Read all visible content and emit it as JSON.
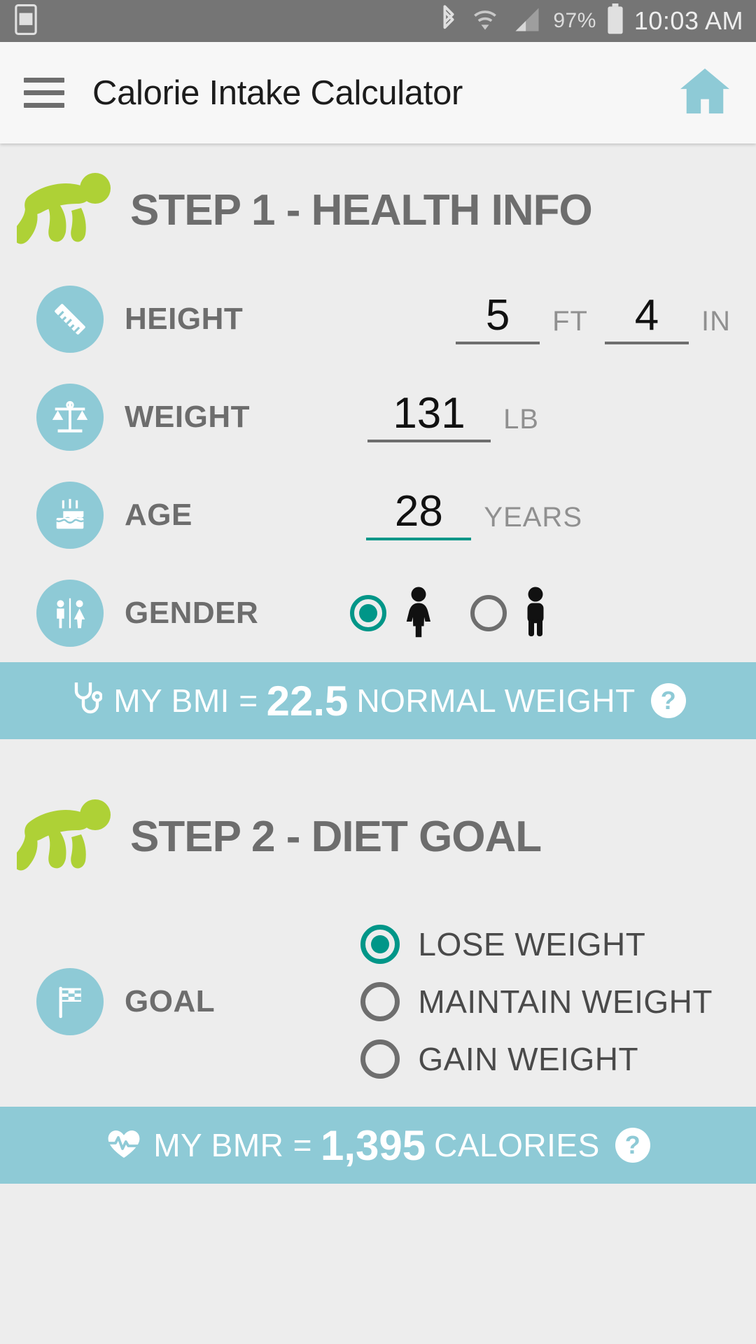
{
  "status_bar": {
    "battery_percent": "97%",
    "clock": "10:03 AM",
    "icons": [
      "photo-icon",
      "bluetooth-icon",
      "wifi-icon",
      "signal-icon",
      "battery-icon"
    ]
  },
  "app_bar": {
    "menu_icon": "hamburger-menu-icon",
    "title": "Calorie Intake Calculator",
    "home_icon": "home-icon"
  },
  "step1": {
    "icon": "runner-icon",
    "title": "STEP 1 - HEALTH INFO",
    "height": {
      "icon": "ruler-icon",
      "label": "HEIGHT",
      "feet_value": "5",
      "feet_unit": "FT",
      "inches_value": "4",
      "inches_unit": "IN"
    },
    "weight": {
      "icon": "scale-icon",
      "label": "WEIGHT",
      "value": "131",
      "unit": "LB"
    },
    "age": {
      "icon": "birthday-cake-icon",
      "label": "AGE",
      "value": "28",
      "unit": "YEARS"
    },
    "gender": {
      "icon": "restroom-sign-icon",
      "label": "GENDER",
      "options": [
        {
          "value": "female",
          "icon": "female-icon",
          "selected": true
        },
        {
          "value": "male",
          "icon": "male-icon",
          "selected": false
        }
      ]
    },
    "bmi_banner": {
      "icon": "stethoscope-icon",
      "prefix": "MY BMI =",
      "value": "22.5",
      "category": "NORMAL WEIGHT",
      "help_label": "?"
    }
  },
  "step2": {
    "icon": "runner-icon",
    "title": "STEP 2 - DIET GOAL",
    "goal": {
      "icon": "flag-icon",
      "label": "GOAL",
      "options": [
        {
          "label": "LOSE WEIGHT",
          "selected": true
        },
        {
          "label": "MAINTAIN WEIGHT",
          "selected": false
        },
        {
          "label": "GAIN WEIGHT",
          "selected": false
        }
      ]
    },
    "bmr_banner": {
      "icon": "heartbeat-icon",
      "prefix": "MY BMR =",
      "value": "1,395",
      "unit": "CALORIES",
      "help_label": "?"
    }
  },
  "colors": {
    "accent_teal": "#009688",
    "banner_blue": "#8ecad6",
    "icon_circle": "#8ecad6",
    "runner_green": "#aed136",
    "status_bar": "#757575"
  }
}
